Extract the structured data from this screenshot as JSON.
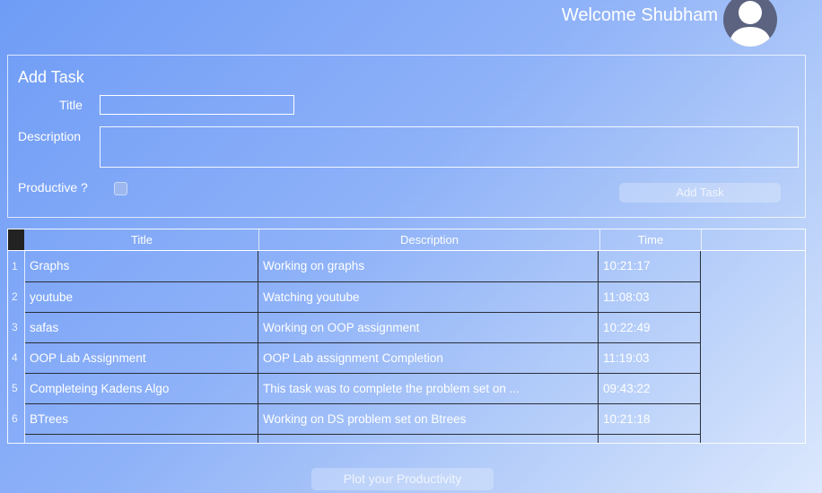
{
  "header": {
    "welcome": "Welcome Shubham",
    "avatar_icon": "user-silhouette-icon"
  },
  "add_task": {
    "panel_title": "Add Task",
    "title_label": "Title",
    "title_value": "",
    "description_label": "Description",
    "description_value": "",
    "productive_label": "Productive ?",
    "productive_checked": false,
    "add_button": "Add Task"
  },
  "table": {
    "columns": [
      "Title",
      "Description",
      "Time"
    ],
    "rows": [
      {
        "num": "1",
        "title": "Graphs",
        "description": "Working on graphs",
        "time": "10:21:17"
      },
      {
        "num": "2",
        "title": "youtube",
        "description": "Watching youtube",
        "time": "11:08:03"
      },
      {
        "num": "3",
        "title": "safas",
        "description": "Working on OOP assignment",
        "time": "10:22:49"
      },
      {
        "num": "4",
        "title": "OOP Lab Assignment",
        "description": "OOP Lab assignment Completion",
        "time": "11:19:03"
      },
      {
        "num": "5",
        "title": "Completeing Kadens Algo",
        "description": "This task was to complete the problem set on ...",
        "time": "09:43:22"
      },
      {
        "num": "6",
        "title": "BTrees",
        "description": "Working on DS problem set on Btrees",
        "time": "10:21:18"
      }
    ]
  },
  "plot_button": "Plot your Productivity"
}
